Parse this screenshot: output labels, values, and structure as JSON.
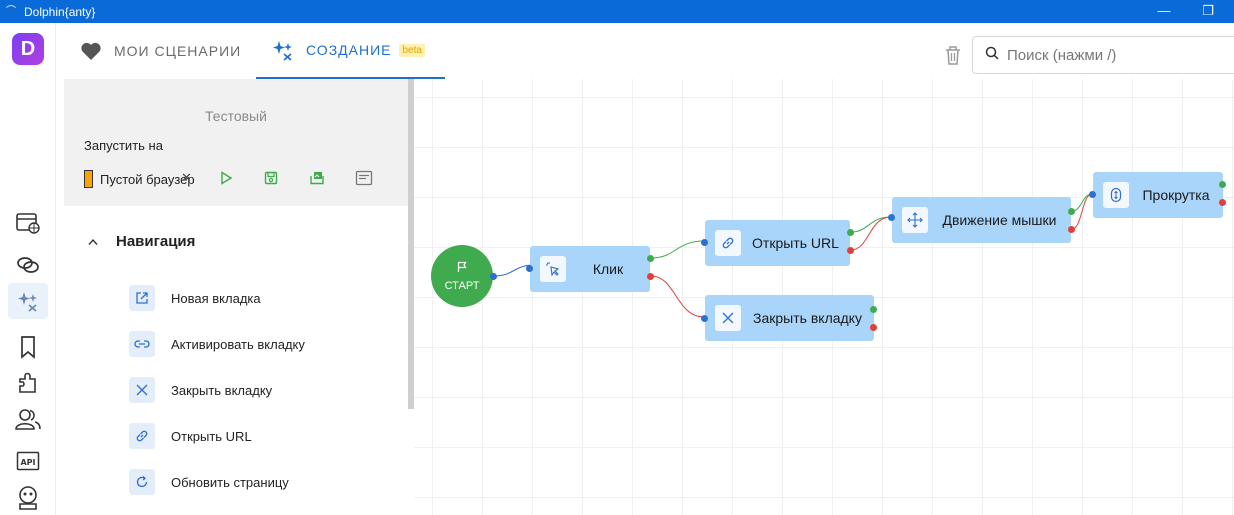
{
  "window": {
    "title": "Dolphin{anty}"
  },
  "tabs": [
    {
      "label": "Мои сценарии",
      "icon": "heart-icon"
    },
    {
      "label": "Создание",
      "icon": "sparkles-icon",
      "badge": "beta"
    }
  ],
  "search": {
    "placeholder": "Поиск (нажми /)"
  },
  "sidebar": {
    "items": [
      "browser-profiles-icon",
      "links-icon",
      "automation-icon",
      "bookmark-icon",
      "extensions-icon",
      "users-icon",
      "api-icon",
      "robot-icon"
    ]
  },
  "panel": {
    "scenario_name": "Тестовый",
    "run_on_label": "Запустить на",
    "browser_value": "Пустой браузер",
    "section": {
      "title": "Навигация"
    },
    "blocks": [
      {
        "label": "Новая вкладка",
        "icon": "external-link-icon"
      },
      {
        "label": "Активировать вкладку",
        "icon": "link-icon"
      },
      {
        "label": "Закрыть вкладку",
        "icon": "close-icon"
      },
      {
        "label": "Открыть URL",
        "icon": "chain-link-icon"
      },
      {
        "label": "Обновить страницу",
        "icon": "refresh-icon"
      }
    ]
  },
  "canvas": {
    "start": {
      "label": "СТАРТ",
      "icon": "flag-icon"
    },
    "nodes": [
      {
        "id": "click",
        "label": "Клик",
        "icon": "cursor-click-icon"
      },
      {
        "id": "open-url",
        "label": "Открыть URL",
        "icon": "chain-link-icon"
      },
      {
        "id": "close-tab",
        "label": "Закрыть вкладку",
        "icon": "close-icon"
      },
      {
        "id": "mouse-move",
        "label": "Движение мышки",
        "icon": "move-arrows-icon"
      },
      {
        "id": "scroll",
        "label": "Прокрутка",
        "icon": "scroll-icon"
      }
    ]
  },
  "colors": {
    "accent": "#1f6fd0",
    "titlebar": "#0a6ad8",
    "node": "#a9d5fb",
    "start": "#3faa4e",
    "ok_port": "#3faa4e",
    "err_port": "#e0403a",
    "in_port": "#2e6fd0"
  }
}
